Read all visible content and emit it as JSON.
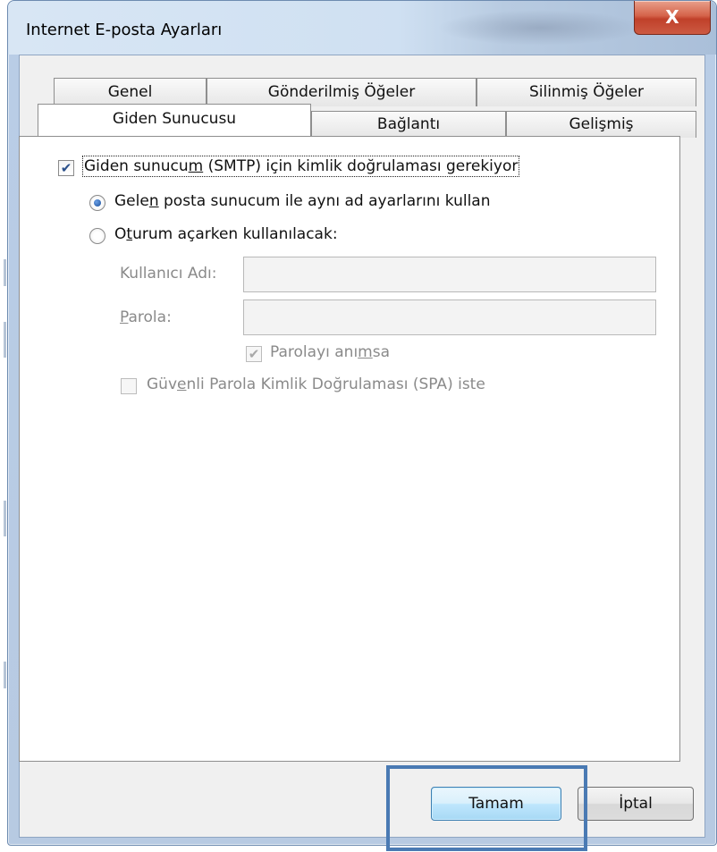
{
  "window": {
    "title": "Internet E-posta Ayarları",
    "close_glyph": "X"
  },
  "tabs": {
    "row1": [
      "Genel",
      "Gönderilmiş Öğeler",
      "Silinmiş Öğeler"
    ],
    "row2": [
      "Giden Sunucusu",
      "Bağlantı",
      "Gelişmiş"
    ],
    "active": "Giden Sunucusu"
  },
  "outgoing": {
    "smtp_auth": {
      "pre": "Giden sunucu",
      "ul": "m",
      "post": " (SMTP) için kimlik doğrulaması gerekiyor",
      "checked": true
    },
    "same_settings": {
      "pre": "Gele",
      "ul": "n",
      "post": " posta sunucum ile aynı ad ayarlarını kullan",
      "selected": true
    },
    "logon_with": {
      "pre": "O",
      "ul": "t",
      "post": "urum açarken kullanılacak:",
      "selected": false
    },
    "username_label": "Kullanıcı Adı:",
    "username_value": "",
    "password_label_ul": "P",
    "password_label_rest": "arola:",
    "password_value": "",
    "remember_password": {
      "pre": "Parolayı anı",
      "ul": "m",
      "post": "sa",
      "checked": true
    },
    "spa": {
      "pre": "Güv",
      "ul": "e",
      "post": "nli Parola Kimlik Doğrulaması (SPA) iste",
      "checked": false
    }
  },
  "buttons": {
    "ok": "Tamam",
    "cancel": "İptal"
  },
  "colors": {
    "accent_highlight": "#4a7ab3",
    "close_button": "#c0402a",
    "check_mark": "#2a4f8a"
  }
}
